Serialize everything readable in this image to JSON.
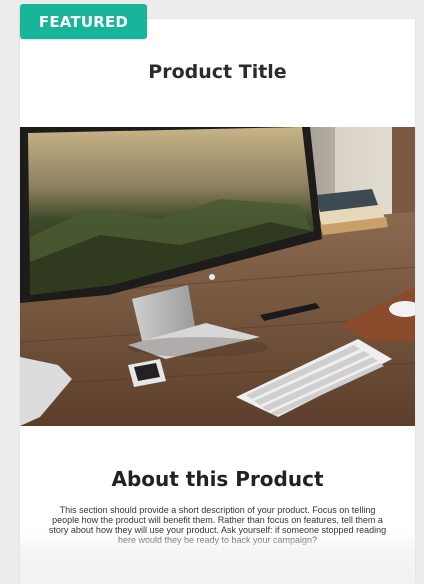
{
  "badge": {
    "label": "FEATURED",
    "color": "#19b59b"
  },
  "product": {
    "title": "Product Title"
  },
  "hero_image": {
    "icon": "desktop-workspace-photo"
  },
  "about": {
    "heading": "About this Product",
    "description": "This section should provide a short description of your product. Focus on telling people how the product will benefit them. Rather than focus on features, tell them a story about how they will use your product. Ask yourself: if someone stopped reading here would they be ready to back your campaign?"
  }
}
